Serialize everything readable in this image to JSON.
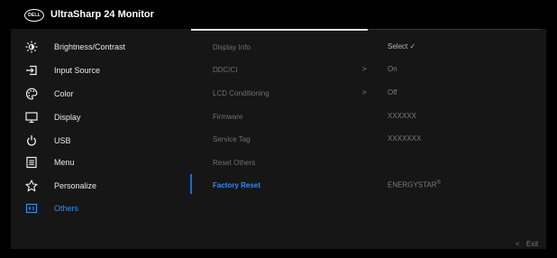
{
  "header": {
    "logo_text": "DELL",
    "title": "UltraSharp 24 Monitor"
  },
  "sidebar": {
    "items": [
      {
        "label": "Brightness/Contrast",
        "icon": "brightness-icon"
      },
      {
        "label": "Input Source",
        "icon": "input-source-icon"
      },
      {
        "label": "Color",
        "icon": "palette-icon"
      },
      {
        "label": "Display",
        "icon": "monitor-icon"
      },
      {
        "label": "USB",
        "icon": "power-icon"
      },
      {
        "label": "Menu",
        "icon": "menu-list-icon"
      },
      {
        "label": "Personalize",
        "icon": "star-icon"
      },
      {
        "label": "Others",
        "icon": "others-icon",
        "active": true
      }
    ]
  },
  "submenu": {
    "items": [
      {
        "label": "Display Info"
      },
      {
        "label": "DDC/CI",
        "has_arrow": true
      },
      {
        "label": "LCD Conditioning",
        "has_arrow": true
      },
      {
        "label": "Firmware"
      },
      {
        "label": "Service Tag"
      },
      {
        "label": "Reset Others"
      },
      {
        "label": "Factory Reset",
        "active": true
      }
    ],
    "arrow_glyph": ">"
  },
  "values": {
    "display_info": "Select ✓",
    "ddc_ci": "On",
    "lcd_conditioning": "Off",
    "firmware": "XXXXXX",
    "service_tag": "XXXXXXX",
    "energy_star": "ENERGYSTAR",
    "energy_star_mark": "®"
  },
  "footer": {
    "exit_label": "Exit",
    "exit_glyph": "<"
  },
  "colors": {
    "accent": "#2e8cff",
    "panel": "#161616",
    "background": "#000000"
  }
}
